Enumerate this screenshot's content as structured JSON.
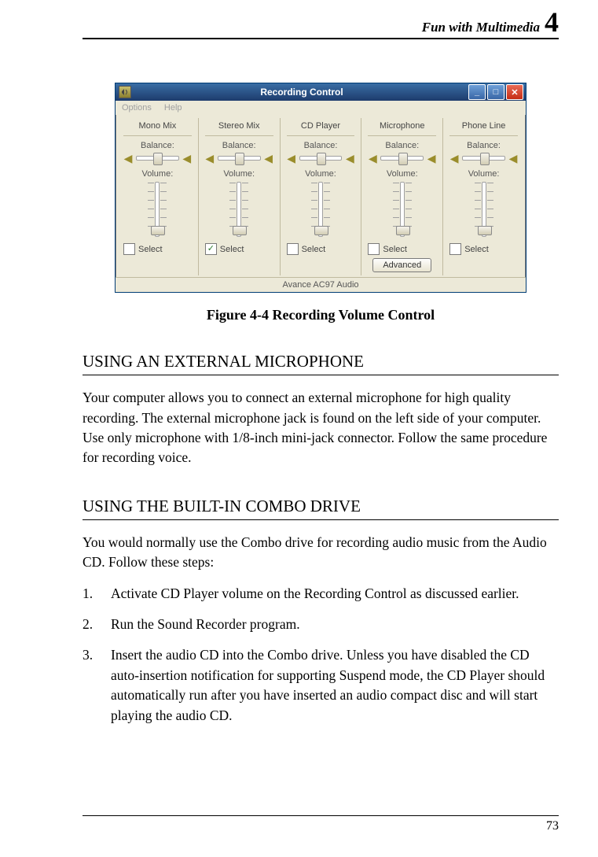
{
  "header": {
    "title": "Fun with Multimedia",
    "chapter": "4"
  },
  "figure": {
    "window_title": "Recording Control",
    "menu": {
      "options": "Options",
      "help": "Help"
    },
    "labels": {
      "balance": "Balance:",
      "volume": "Volume:",
      "select": "Select",
      "advanced": "Advanced"
    },
    "status": "Avance AC97 Audio",
    "channels": [
      {
        "title": "Mono Mix",
        "selected": false,
        "vpos": 55,
        "advanced": false
      },
      {
        "title": "Stereo Mix",
        "selected": true,
        "vpos": 55,
        "advanced": false
      },
      {
        "title": "CD Player",
        "selected": false,
        "vpos": 55,
        "advanced": false
      },
      {
        "title": "Microphone",
        "selected": false,
        "vpos": 55,
        "advanced": true
      },
      {
        "title": "Phone Line",
        "selected": false,
        "vpos": 55,
        "advanced": false
      }
    ],
    "caption": "Figure 4-4 Recording Volume Control"
  },
  "section1": {
    "heading": "USING AN EXTERNAL MICROPHONE",
    "body": "Your computer allows you to connect an external microphone for high quality recording. The external microphone jack is found on the left side of your computer. Use only microphone with 1/8-inch mini-jack connector. Follow the same procedure for recording voice."
  },
  "section2": {
    "heading": "USING THE BUILT-IN COMBO DRIVE",
    "intro": "You would normally use the Combo drive for recording audio music from the Audio CD. Follow these steps:",
    "items": [
      "Activate CD Player volume on the Recording Control as discussed earlier.",
      "Run the Sound Recorder program.",
      "Insert the audio CD into the Combo drive. Unless you have disabled the CD auto-insertion notification for supporting Suspend mode, the CD Player should automatically run after you have inserted an audio compact disc and will start playing the audio CD."
    ]
  },
  "footer": {
    "page": "73"
  }
}
